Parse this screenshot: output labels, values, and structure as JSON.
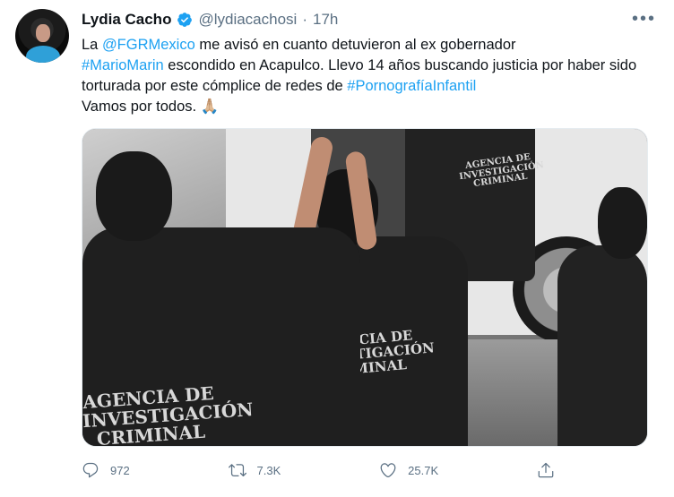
{
  "tweet": {
    "name": "Lydia Cacho",
    "handle": "@lydiacachosi",
    "dot": "·",
    "time": "17h",
    "text_parts": {
      "p1": "La ",
      "mention": "@FGRMexico",
      "p2": " me avisó en cuanto detuvieron al ex gobernador",
      "hashtag1": "#MarioMarin",
      "p3": " escondido en Acapulco. Llevo 14 años buscando justicia por haber sido torturada por este cómplice de  redes de ",
      "hashtag2": "#PornografíaInfantil",
      "p4": "Vamos por todos. ",
      "emoji": "🙏🏼"
    },
    "image_text": {
      "vest1": "AGENCIA DE INVESTIGACIÓN CRIMINAL",
      "vest2": "AGENCIA DE INVESTIGACIÓN CRIMINAL",
      "vest3": "AGENCIA DE INVESTIGACIÓN CRIMINAL"
    },
    "actions": {
      "replies": "972",
      "retweets": "7.3K",
      "likes": "25.7K"
    },
    "icons": {
      "verified": "verified-badge-icon",
      "more": "more-options-icon",
      "reply": "reply-icon",
      "retweet": "retweet-icon",
      "like": "like-icon",
      "share": "share-icon"
    },
    "colors": {
      "accent": "#1da1f2",
      "muted": "#5b7083",
      "text": "#0f1419"
    }
  }
}
